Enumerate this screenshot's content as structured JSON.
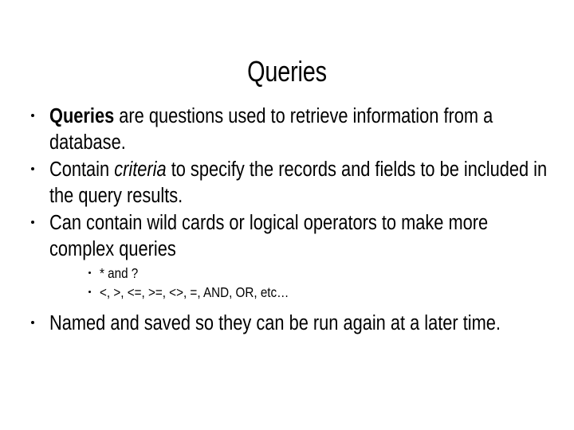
{
  "slide": {
    "title": "Queries",
    "background_color": "#ffffff",
    "text_color": "#000000",
    "bullets": [
      {
        "id": "definition",
        "lead_bold": "Queries",
        "rest": " are questions used to retrieve information from a database.",
        "full_text": "Queries are questions used to retrieve information from a database."
      },
      {
        "id": "criteria",
        "before_italic": "Contain ",
        "italic": "criteria",
        "after_italic": " to specify the records and fields to be included in the query results.",
        "full_text": "Contain criteria to specify the records and fields to be included in the query results."
      },
      {
        "id": "wildcards",
        "full_text": "Can contain wild cards or logical operators to make more complex queries",
        "sub_bullets": [
          {
            "id": "wildcard-chars",
            "text": "* and ?"
          },
          {
            "id": "operators",
            "text": "<, >, <=, >=, <>, =, AND, OR, etc…"
          }
        ]
      },
      {
        "id": "named-saved",
        "full_text": "Named and saved so they can be run again at a later time."
      }
    ]
  }
}
